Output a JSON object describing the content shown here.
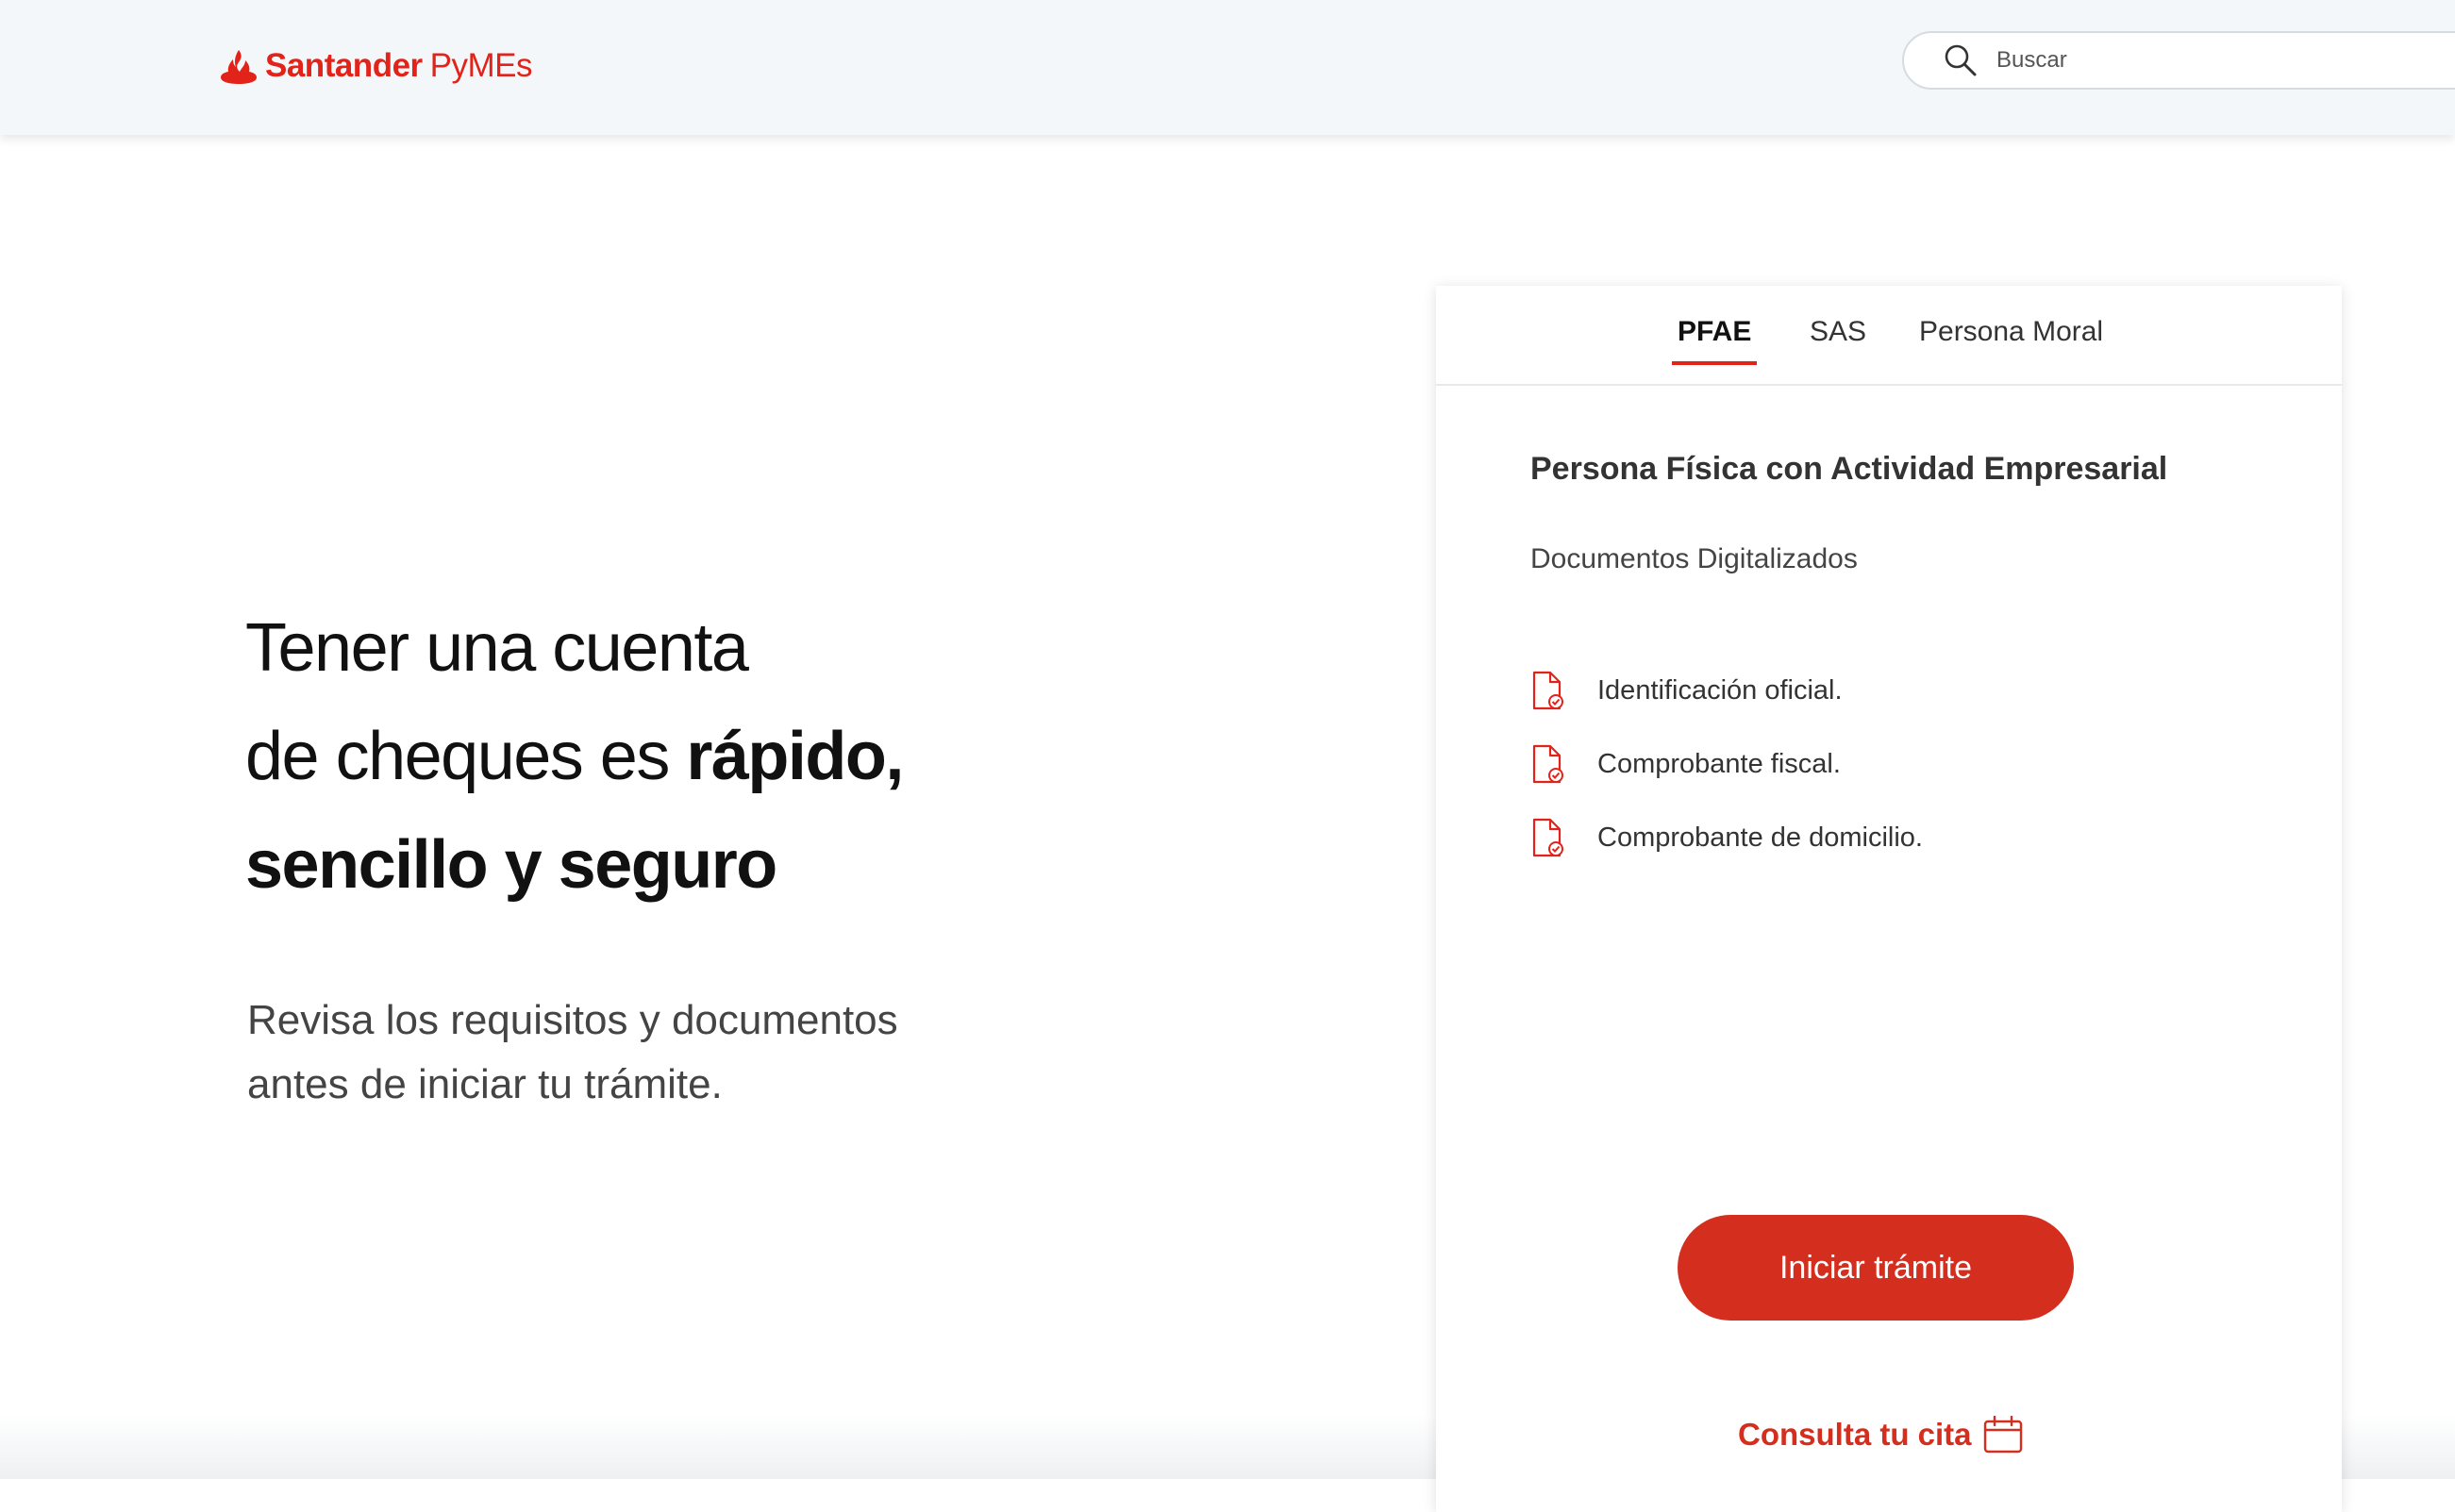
{
  "header": {
    "logo_brand": "Santander",
    "logo_product": "PyMEs",
    "logo_icon": "flame-icon",
    "search": {
      "placeholder": "Buscar",
      "value": "",
      "icon": "search-icon"
    }
  },
  "hero": {
    "title_line1": "Tener una cuenta",
    "title_line2_regular": "de cheques es ",
    "title_line2_bold": "rápido,",
    "title_line3": "sencillo y seguro",
    "subtitle_line1": "Revisa los requisitos y documentos",
    "subtitle_line2": "antes de iniciar tu trámite."
  },
  "card": {
    "tabs": [
      {
        "label": "PFAE",
        "active": true
      },
      {
        "label": "SAS",
        "active": false
      },
      {
        "label": "Persona Moral",
        "active": false
      }
    ],
    "title": "Persona Física con Actividad Empresarial",
    "subtitle": "Documentos Digitalizados",
    "documents": [
      {
        "label": "Identificación oficial.",
        "icon": "document-check-icon"
      },
      {
        "label": "Comprobante fiscal.",
        "icon": "document-check-icon"
      },
      {
        "label": "Comprobante de domicilio.",
        "icon": "document-check-icon"
      }
    ],
    "cta_label": "Iniciar trámite",
    "appointment_label": "Consulta tu cita",
    "appointment_icon": "calendar-icon"
  },
  "colors": {
    "brand_red": "#e2231a",
    "button_red": "#d42e1f",
    "header_bg": "#f4f7fa"
  }
}
